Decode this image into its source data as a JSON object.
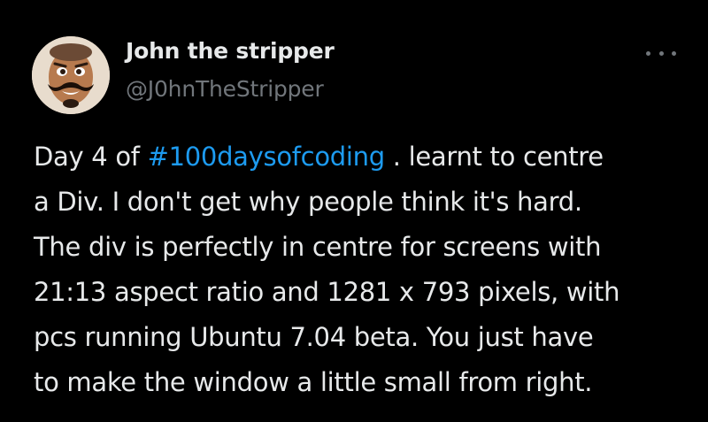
{
  "author": {
    "display_name": "John the stripper",
    "handle": "@J0hnTheStripper",
    "avatar_icon": "avatar-photo"
  },
  "menu": {
    "icon": "more-options-icon"
  },
  "tweet": {
    "line1_before": "Day 4 of ",
    "hashtag": "#100daysofcoding",
    "line1_after": " . learnt to centre",
    "lines": [
      "a Div. I don't get why people think it's hard.",
      "The div is perfectly in centre for screens with",
      "21:13 aspect ratio and 1281 x 793 pixels, with",
      "pcs running Ubuntu 7.04 beta. You just have",
      "to make the window a little small from right."
    ]
  },
  "colors": {
    "background": "#000000",
    "text": "#e7e9ea",
    "secondary": "#71767b",
    "link": "#1d9bf0"
  }
}
